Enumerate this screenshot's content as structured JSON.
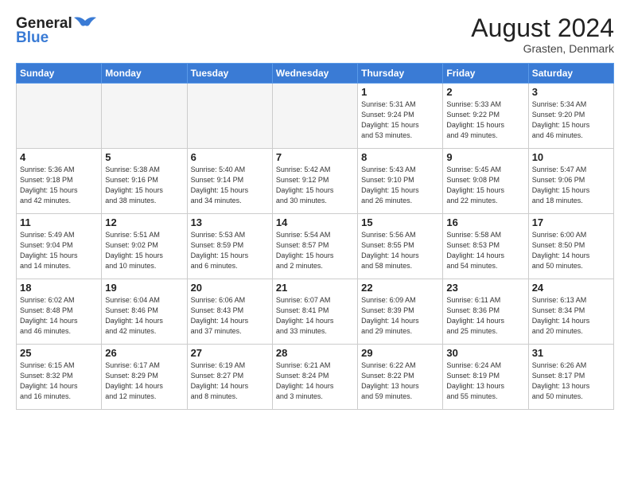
{
  "header": {
    "logo_line1": "General",
    "logo_line2": "Blue",
    "month_title": "August 2024",
    "location": "Grasten, Denmark"
  },
  "weekdays": [
    "Sunday",
    "Monday",
    "Tuesday",
    "Wednesday",
    "Thursday",
    "Friday",
    "Saturday"
  ],
  "weeks": [
    [
      {
        "day": "",
        "info": ""
      },
      {
        "day": "",
        "info": ""
      },
      {
        "day": "",
        "info": ""
      },
      {
        "day": "",
        "info": ""
      },
      {
        "day": "1",
        "info": "Sunrise: 5:31 AM\nSunset: 9:24 PM\nDaylight: 15 hours\nand 53 minutes."
      },
      {
        "day": "2",
        "info": "Sunrise: 5:33 AM\nSunset: 9:22 PM\nDaylight: 15 hours\nand 49 minutes."
      },
      {
        "day": "3",
        "info": "Sunrise: 5:34 AM\nSunset: 9:20 PM\nDaylight: 15 hours\nand 46 minutes."
      }
    ],
    [
      {
        "day": "4",
        "info": "Sunrise: 5:36 AM\nSunset: 9:18 PM\nDaylight: 15 hours\nand 42 minutes."
      },
      {
        "day": "5",
        "info": "Sunrise: 5:38 AM\nSunset: 9:16 PM\nDaylight: 15 hours\nand 38 minutes."
      },
      {
        "day": "6",
        "info": "Sunrise: 5:40 AM\nSunset: 9:14 PM\nDaylight: 15 hours\nand 34 minutes."
      },
      {
        "day": "7",
        "info": "Sunrise: 5:42 AM\nSunset: 9:12 PM\nDaylight: 15 hours\nand 30 minutes."
      },
      {
        "day": "8",
        "info": "Sunrise: 5:43 AM\nSunset: 9:10 PM\nDaylight: 15 hours\nand 26 minutes."
      },
      {
        "day": "9",
        "info": "Sunrise: 5:45 AM\nSunset: 9:08 PM\nDaylight: 15 hours\nand 22 minutes."
      },
      {
        "day": "10",
        "info": "Sunrise: 5:47 AM\nSunset: 9:06 PM\nDaylight: 15 hours\nand 18 minutes."
      }
    ],
    [
      {
        "day": "11",
        "info": "Sunrise: 5:49 AM\nSunset: 9:04 PM\nDaylight: 15 hours\nand 14 minutes."
      },
      {
        "day": "12",
        "info": "Sunrise: 5:51 AM\nSunset: 9:02 PM\nDaylight: 15 hours\nand 10 minutes."
      },
      {
        "day": "13",
        "info": "Sunrise: 5:53 AM\nSunset: 8:59 PM\nDaylight: 15 hours\nand 6 minutes."
      },
      {
        "day": "14",
        "info": "Sunrise: 5:54 AM\nSunset: 8:57 PM\nDaylight: 15 hours\nand 2 minutes."
      },
      {
        "day": "15",
        "info": "Sunrise: 5:56 AM\nSunset: 8:55 PM\nDaylight: 14 hours\nand 58 minutes."
      },
      {
        "day": "16",
        "info": "Sunrise: 5:58 AM\nSunset: 8:53 PM\nDaylight: 14 hours\nand 54 minutes."
      },
      {
        "day": "17",
        "info": "Sunrise: 6:00 AM\nSunset: 8:50 PM\nDaylight: 14 hours\nand 50 minutes."
      }
    ],
    [
      {
        "day": "18",
        "info": "Sunrise: 6:02 AM\nSunset: 8:48 PM\nDaylight: 14 hours\nand 46 minutes."
      },
      {
        "day": "19",
        "info": "Sunrise: 6:04 AM\nSunset: 8:46 PM\nDaylight: 14 hours\nand 42 minutes."
      },
      {
        "day": "20",
        "info": "Sunrise: 6:06 AM\nSunset: 8:43 PM\nDaylight: 14 hours\nand 37 minutes."
      },
      {
        "day": "21",
        "info": "Sunrise: 6:07 AM\nSunset: 8:41 PM\nDaylight: 14 hours\nand 33 minutes."
      },
      {
        "day": "22",
        "info": "Sunrise: 6:09 AM\nSunset: 8:39 PM\nDaylight: 14 hours\nand 29 minutes."
      },
      {
        "day": "23",
        "info": "Sunrise: 6:11 AM\nSunset: 8:36 PM\nDaylight: 14 hours\nand 25 minutes."
      },
      {
        "day": "24",
        "info": "Sunrise: 6:13 AM\nSunset: 8:34 PM\nDaylight: 14 hours\nand 20 minutes."
      }
    ],
    [
      {
        "day": "25",
        "info": "Sunrise: 6:15 AM\nSunset: 8:32 PM\nDaylight: 14 hours\nand 16 minutes."
      },
      {
        "day": "26",
        "info": "Sunrise: 6:17 AM\nSunset: 8:29 PM\nDaylight: 14 hours\nand 12 minutes."
      },
      {
        "day": "27",
        "info": "Sunrise: 6:19 AM\nSunset: 8:27 PM\nDaylight: 14 hours\nand 8 minutes."
      },
      {
        "day": "28",
        "info": "Sunrise: 6:21 AM\nSunset: 8:24 PM\nDaylight: 14 hours\nand 3 minutes."
      },
      {
        "day": "29",
        "info": "Sunrise: 6:22 AM\nSunset: 8:22 PM\nDaylight: 13 hours\nand 59 minutes."
      },
      {
        "day": "30",
        "info": "Sunrise: 6:24 AM\nSunset: 8:19 PM\nDaylight: 13 hours\nand 55 minutes."
      },
      {
        "day": "31",
        "info": "Sunrise: 6:26 AM\nSunset: 8:17 PM\nDaylight: 13 hours\nand 50 minutes."
      }
    ]
  ]
}
